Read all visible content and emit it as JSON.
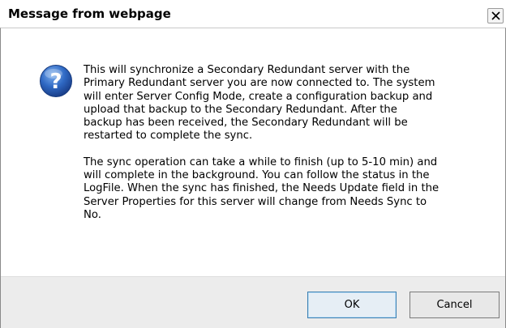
{
  "window": {
    "title": "Message from webpage",
    "close_glyph": "✕"
  },
  "message": {
    "icon": "question-icon",
    "paragraph1": "This will synchronize a Secondary Redundant server with the\nPrimary Redundant server you are now connected to. The system\nwill enter Server Config Mode, create a configuration backup and\nupload that backup to the Secondary Redundant. After the\nbackup has been received, the Secondary Redundant will be\nrestarted to complete the sync.",
    "paragraph2": "The sync operation can take a while to finish (up to 5-10 min) and\nwill complete in the background. You can follow the status in the\nLogFile. When the sync has finished, the Needs Update field in the\nServer Properties for this server will change from Needs Sync to\nNo."
  },
  "buttons": {
    "ok_label": "OK",
    "cancel_label": "Cancel"
  },
  "colors": {
    "icon_blue": "#2b5fb8",
    "footer_bg": "#ececec",
    "default_button_border": "#3c7fb1"
  }
}
